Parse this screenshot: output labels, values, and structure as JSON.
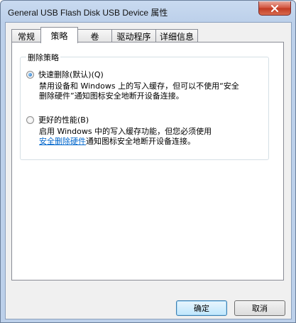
{
  "window": {
    "title": "General USB Flash Disk USB Device 属性"
  },
  "tabs": [
    {
      "label": "常规",
      "active": false
    },
    {
      "label": "策略",
      "active": true
    },
    {
      "label": "卷",
      "active": false
    },
    {
      "label": "驱动程序",
      "active": false
    },
    {
      "label": "详细信息",
      "active": false
    }
  ],
  "removal_policy": {
    "group_title": "删除策略",
    "option_quick": {
      "label": "快速删除(默认)(Q)",
      "checked": true,
      "desc_line1": "禁用设备和 Windows 上的写入缓存，但可以不使用“安全",
      "desc_line2": "删除硬件”通知图标安全地断开设备连接。"
    },
    "option_performance": {
      "label": "更好的性能(B)",
      "checked": false,
      "desc_line1": "启用 Windows 中的写入缓存功能，但您必须使用",
      "desc_link": "安全删除硬件",
      "desc_line2_rest": "通知图标安全地断开设备连接。"
    }
  },
  "buttons": {
    "ok": "确定",
    "cancel": "取消"
  },
  "colors": {
    "title_bar": "#bcd0ea",
    "close_button": "#c13a22",
    "link": "#0066cc"
  }
}
